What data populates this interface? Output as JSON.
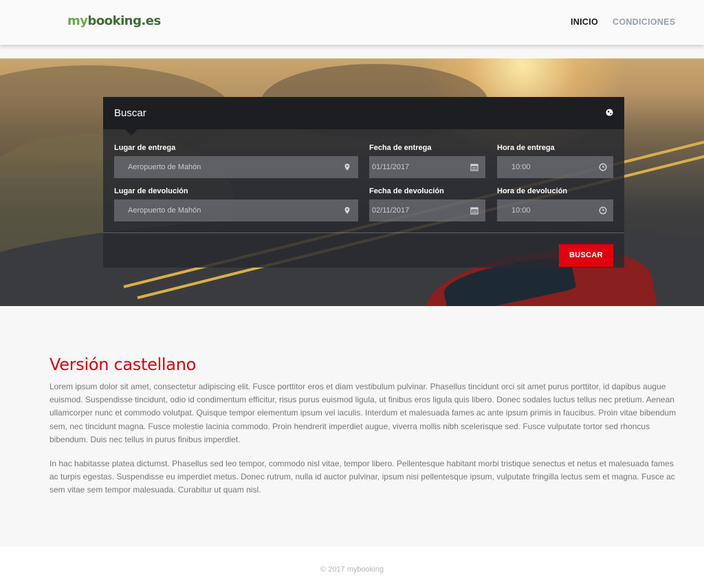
{
  "header": {
    "logo_part1": "my",
    "logo_part2": "booking.es",
    "nav": [
      {
        "label": "INICIO"
      },
      {
        "label": "CONDICIONES"
      }
    ]
  },
  "search": {
    "title": "Buscar",
    "pickup_place_label": "Lugar de entrega",
    "pickup_place_value": "Aeropuerto de Mahón",
    "pickup_date_label": "Fecha de entrega",
    "pickup_date_value": "01/11/2017",
    "pickup_time_label": "Hora de entrega",
    "pickup_time_value": "10:00",
    "return_place_label": "Lugar de devolución",
    "return_place_value": "Aeropuerto de Mahón",
    "return_date_label": "Fecha de devolución",
    "return_date_value": "02/11/2017",
    "return_time_label": "Hora de devolución",
    "return_time_value": "10:00",
    "submit_label": "BUSCAR"
  },
  "content": {
    "title": "Versión castellano",
    "paragraph1": "Lorem ipsum dolor sit amet, consectetur adipiscing elit. Fusce porttitor eros et diam vestibulum pulvinar. Phasellus tincidunt orci sit amet purus porttitor, id dapibus augue euismod. Suspendisse tincidunt, odio id condimentum efficitur, risus purus euismod ligula, ut finibus eros ligula quis libero. Donec sodales luctus tellus nec pretium. Aenean ullamcorper nunc et commodo volutpat. Quisque tempor elementum ipsum vel iaculis. Interdum et malesuada fames ac ante ipsum primis in faucibus. Proin vitae bibendum sem, nec tincidunt magna. Fusce molestie lacinia commodo. Proin hendrerit imperdiet augue, viverra mollis nibh scelerisque sed. Fusce vulputate tortor sed rhoncus bibendum. Duis nec tellus in purus finibus imperdiet.",
    "paragraph2": "In hac habitasse platea dictumst. Phasellus sed leo tempor, commodo nisl vitae, tempor libero. Pellentesque habitant morbi tristique senectus et netus et malesuada fames ac turpis egestas. Suspendisse eu imperdiet metus. Donec rutrum, nulla id auctor pulvinar, ipsum nisi pellentesque ipsum, vulputate fringilla lectus sem et magna. Fusce ac sem vitae sem tempor malesuada. Curabitur ut quam nisl."
  },
  "footer": {
    "copyright": "© 2017 mybooking"
  },
  "colors": {
    "accent": "#e0000f",
    "logo_light": "#6aa84f",
    "logo_dark": "#3f6b35"
  },
  "icons": [
    "globe-icon",
    "map-pin-icon",
    "calendar-icon",
    "clock-icon"
  ]
}
